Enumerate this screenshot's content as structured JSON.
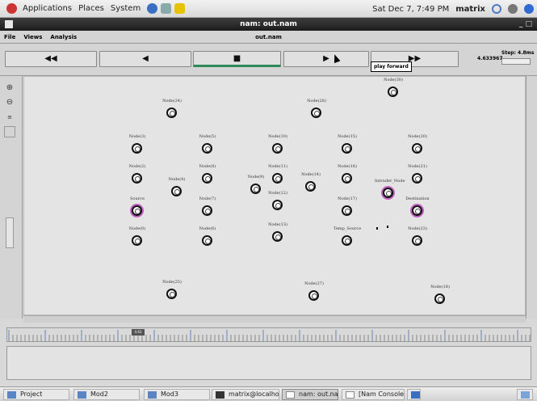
{
  "top_panel": {
    "menus": [
      "Applications",
      "Places",
      "System"
    ],
    "datetime": "Sat Dec 7, 7:49 PM",
    "user": "matrix"
  },
  "window": {
    "title": "nam: out.nam"
  },
  "nam_menu": {
    "items": [
      "File",
      "Views",
      "Analysis"
    ],
    "file_label": "out.nam"
  },
  "controls": {
    "fast_rewind": "◀◀",
    "rewind": "◀",
    "stop": "■",
    "play": "▶",
    "fast_forward": "▶▶",
    "tooltip": "play forward",
    "time": "4.633967",
    "step_label": "Step: 4.8ms"
  },
  "nodes": [
    {
      "label": "Node(24)"
    },
    {
      "label": "Node(28)"
    },
    {
      "label": "Node(30)"
    },
    {
      "label": "Node(3)"
    },
    {
      "label": "Node(5)"
    },
    {
      "label": "Node(10)"
    },
    {
      "label": "Node(15)"
    },
    {
      "label": "Node(20)"
    },
    {
      "label": "Node(2)"
    },
    {
      "label": "Node(4)"
    },
    {
      "label": "Node(8)"
    },
    {
      "label": "Node(9)"
    },
    {
      "label": "Node(11)"
    },
    {
      "label": "Node(14)"
    },
    {
      "label": "Node(16)"
    },
    {
      "label": "Intruder_Node"
    },
    {
      "label": "Node(21)"
    },
    {
      "label": "Source"
    },
    {
      "label": "Node(7)"
    },
    {
      "label": "Node(12)"
    },
    {
      "label": "Node(17)"
    },
    {
      "label": "Destination"
    },
    {
      "label": "Node(0)"
    },
    {
      "label": "Node(6)"
    },
    {
      "label": "Node(13)"
    },
    {
      "label": "Temp_Source"
    },
    {
      "label": "Node(23)"
    },
    {
      "label": "Node(25)"
    },
    {
      "label": "Node(27)"
    },
    {
      "label": "Node(18)"
    }
  ],
  "timeline": {
    "thumb_label": "4.63"
  },
  "taskbar": {
    "items": [
      "Project",
      "Mod2",
      "Mod3",
      "matrix@localhos...",
      "nam: out.nam",
      "[Nam Console v1..."
    ]
  }
}
